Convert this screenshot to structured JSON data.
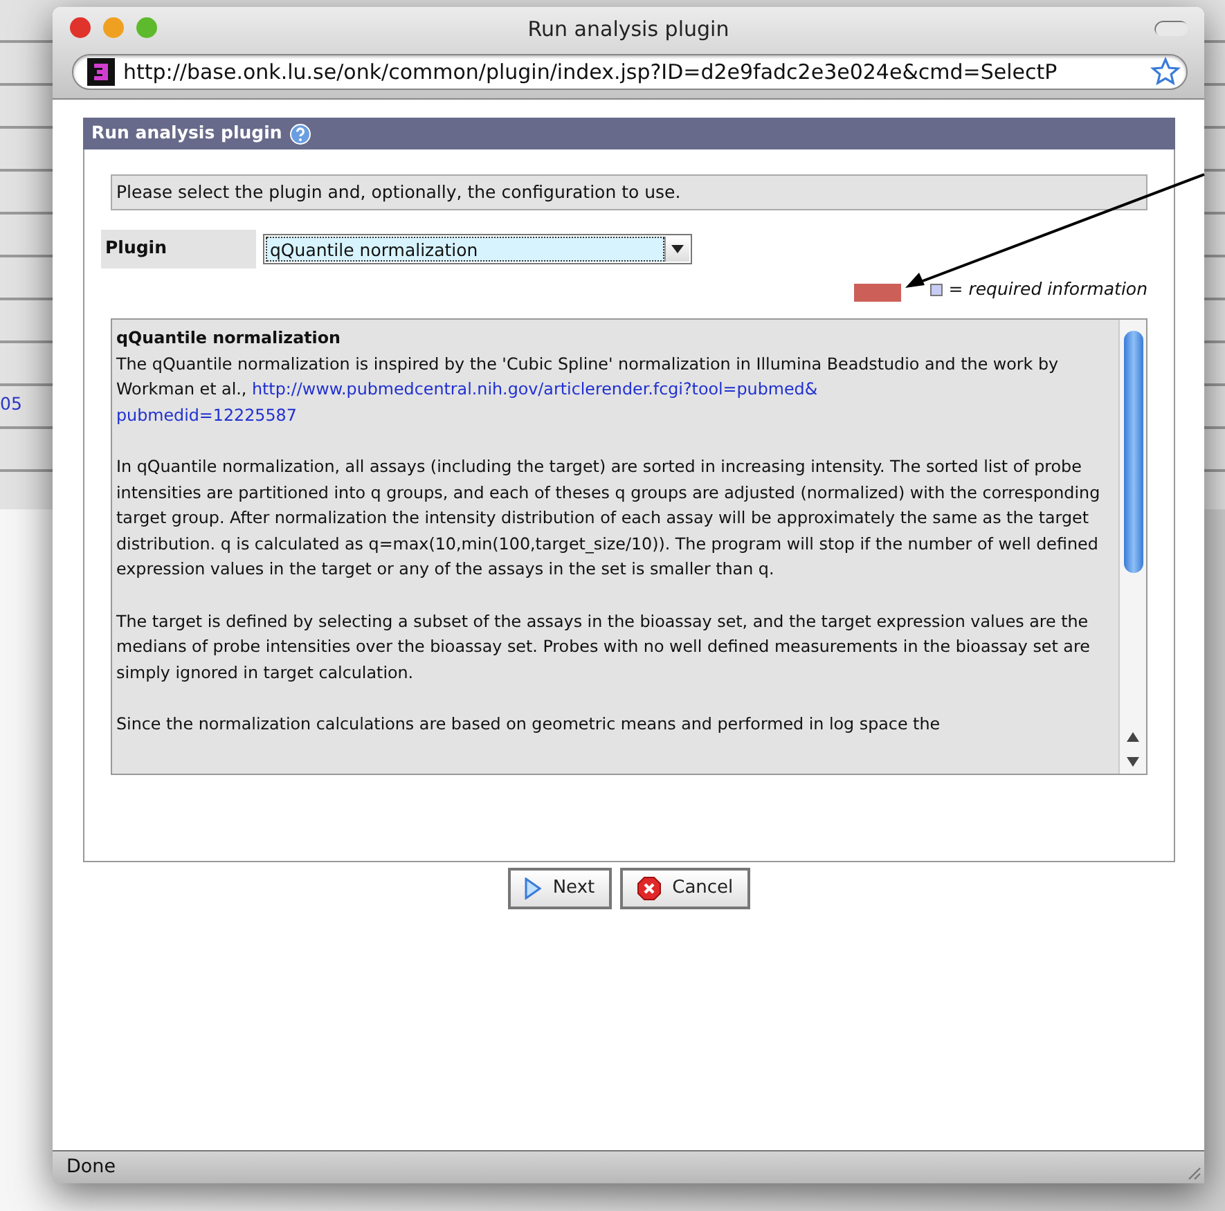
{
  "background_page": {
    "link_text": "05"
  },
  "window": {
    "title": "Run analysis plugin"
  },
  "address_bar": {
    "url": "http://base.onk.lu.se/onk/common/plugin/index.jsp?ID=d2e9fadc2e3e024e&cmd=SelectP"
  },
  "panel": {
    "title": "Run analysis plugin",
    "instructions": "Please select the plugin and, optionally, the configuration to use.",
    "plugin_label": "Plugin",
    "plugin_value": "qQuantile normalization",
    "required_legend": "= required information",
    "description": {
      "title": "qQuantile normalization",
      "paragraphs": [
        {
          "text": "The qQuantile normalization is inspired by the 'Cubic Spline' normalization in Illumina Beadstudio and the work by Workman et al.,",
          "link_lines": [
            "http://www.pubmedcentral.nih.gov/articlerender.fcgi?tool=pubmed&",
            "pubmedid=12225587"
          ]
        },
        {
          "text": "In qQuantile normalization, all assays (including the target) are sorted in increasing intensity. The sorted list of probe intensities are partitioned into q groups, and each of theses q groups are adjusted (normalized) with the corresponding target group. After normalization the intensity distribution of each assay will be approximately the same as the target distribution. q is calculated as q=max(10,min(100,target_size/10)). The program will stop if the number of well defined expression values in the target or any of the assays in the set is smaller than q."
        },
        {
          "text": "The target is defined by selecting a subset of the assays in the bioassay set, and the target expression values are the medians of probe intensities over the bioassay set. Probes with no well defined measurements in the bioassay set are simply ignored in target calculation."
        },
        {
          "text": "Since the normalization calculations are based on geometric means and performed in log space the"
        }
      ]
    }
  },
  "buttons": [
    {
      "label": "Next",
      "kind": "next"
    },
    {
      "label": "Cancel",
      "kind": "cancel"
    }
  ],
  "status_bar": {
    "text": "Done"
  }
}
